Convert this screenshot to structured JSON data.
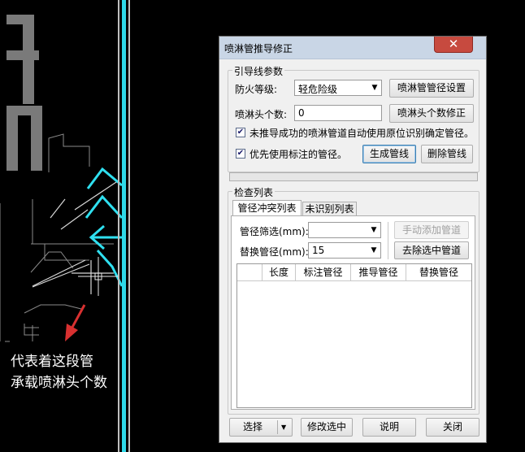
{
  "annotation": {
    "line1": "代表着这段管",
    "line2": "承载喷淋头个数"
  },
  "dialog": {
    "title": "喷淋管推导修正",
    "close_symbol": "✕",
    "guide_group": {
      "label": "引导线参数",
      "fire_level_label": "防火等级:",
      "fire_level_value": "轻危险级",
      "pipe_size_settings_label": "喷淋管管径设置",
      "sprinkler_count_label": "喷淋头个数:",
      "sprinkler_count_value": "0",
      "sprinkler_count_fix_label": "喷淋头个数修正",
      "auto_original_label": "未推导成功的喷淋管道自动使用原位识别确定管径。",
      "auto_original_checked": true,
      "prefer_marked_label": "优先使用标注的管径。",
      "prefer_marked_checked": true,
      "generate_label": "生成管线",
      "delete_label": "删除管线"
    },
    "progress": 0,
    "check_group": {
      "label": "检查列表",
      "tabs": [
        "管径冲突列表",
        "未识别列表"
      ],
      "filter_label": "管径筛选(mm):",
      "filter_value": "",
      "replace_label": "替换管径(mm):",
      "replace_value": "15",
      "manual_add_label": "手动添加管道",
      "remove_selected_label": "去除选中管道",
      "columns": [
        "",
        "长度",
        "标注管径",
        "推导管径",
        "替换管径"
      ]
    },
    "footer": {
      "select_label": "选择",
      "modify_label": "修改选中",
      "help_label": "说明",
      "close_label": "关闭"
    }
  }
}
